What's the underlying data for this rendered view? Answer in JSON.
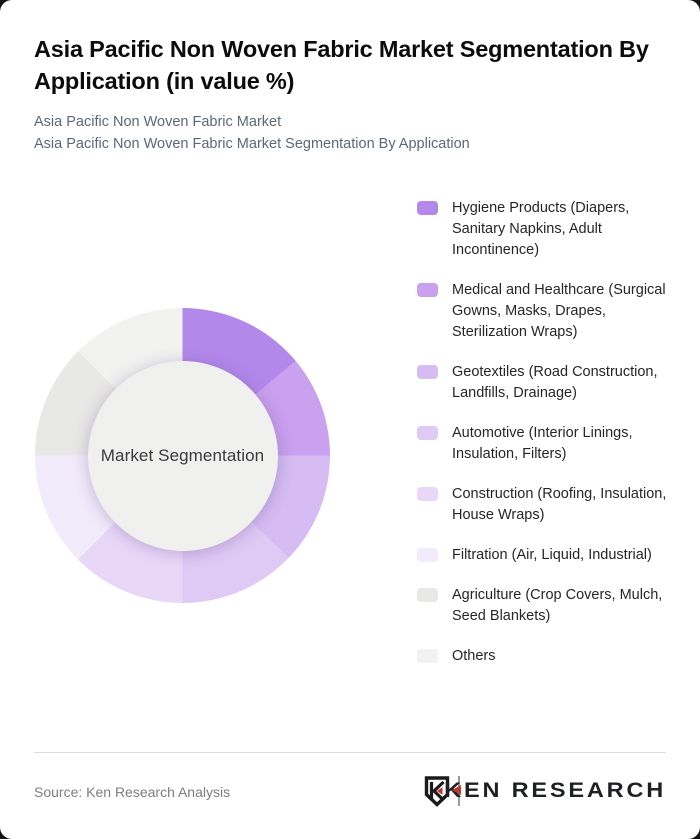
{
  "page": {
    "title": "Asia Pacific Non Woven Fabric Market Segmentation By Application (in value %)",
    "subtitle_line1": "Asia Pacific Non Woven Fabric Market",
    "subtitle_line2": "Asia Pacific Non Woven Fabric Market Segmentation By Application"
  },
  "chart_data": {
    "type": "pie",
    "donut": true,
    "title": "Asia Pacific Non Woven Fabric Market Segmentation By Application (in value %)",
    "center_label": "Market Segmentation",
    "legend_position": "right",
    "value_labels_shown": false,
    "start_angle_deg": 0,
    "segments": [
      {
        "label": "Hygiene Products (Diapers, Sanitary Napkins, Adult Incontinence)",
        "value": 13.9,
        "color": "#b388eb"
      },
      {
        "label": "Medical and Healthcare (Surgical Gowns, Masks, Drapes, Sterilization Wraps)",
        "value": 11.1,
        "color": "#c9a1ef"
      },
      {
        "label": "Geotextiles (Road Construction, Landfills, Drainage)",
        "value": 12.2,
        "color": "#d6bcf2"
      },
      {
        "label": "Automotive (Interior Linings, Insulation, Filters)",
        "value": 12.8,
        "color": "#dfc9f5"
      },
      {
        "label": "Construction (Roofing, Insulation, House Wraps)",
        "value": 12.5,
        "color": "#e9d7f8"
      },
      {
        "label": "Filtration (Air, Liquid, Industrial)",
        "value": 12.5,
        "color": "#f2ebfb"
      },
      {
        "label": "Agriculture (Crop Covers, Mulch, Seed Blankets)",
        "value": 12.5,
        "color": "#e8e8e6"
      },
      {
        "label": "Others",
        "value": 12.5,
        "color": "#f2f2f1"
      }
    ]
  },
  "footer": {
    "source": "Source: Ken Research Analysis",
    "logo_text": "KEN RESEARCH",
    "logo_colors": {
      "mark": "#1b1b1d",
      "accent": "#c0392f"
    }
  }
}
